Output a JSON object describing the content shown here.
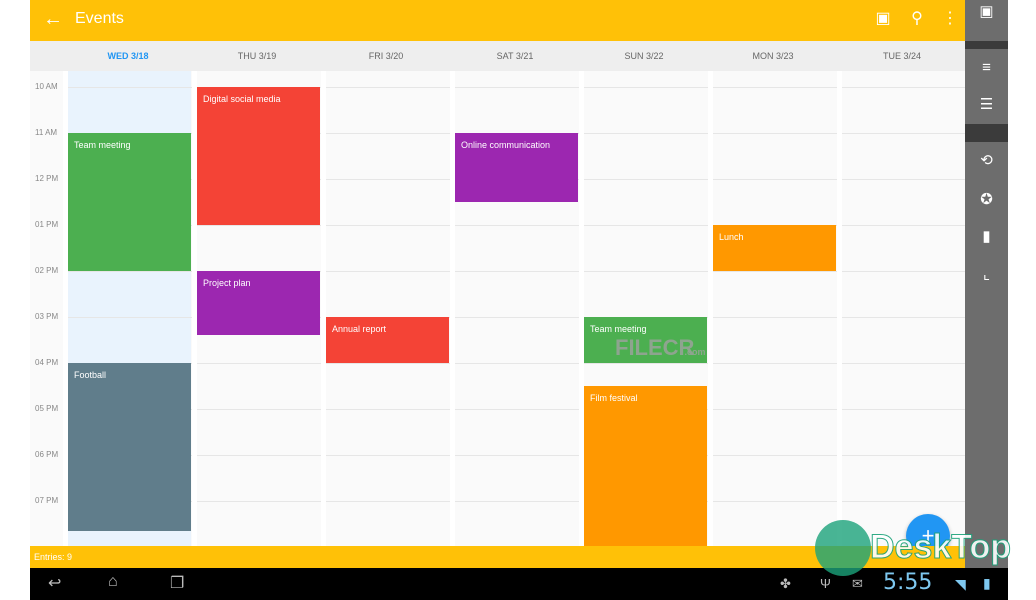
{
  "app": {
    "title": "Events",
    "back_icon": "arrow-left-icon"
  },
  "toolbar": {
    "icons": [
      "calendar-today-icon",
      "search-icon",
      "more-vert-icon"
    ]
  },
  "days": [
    {
      "label": "WED 3/18",
      "today": true
    },
    {
      "label": "THU 3/19"
    },
    {
      "label": "FRI 3/20"
    },
    {
      "label": "SAT 3/21"
    },
    {
      "label": "SUN 3/22"
    },
    {
      "label": "MON 3/23"
    },
    {
      "label": "TUE 3/24"
    }
  ],
  "times": [
    "10 AM",
    "11 AM",
    "12 PM",
    "01 PM",
    "02 PM",
    "03 PM",
    "04 PM",
    "05 PM",
    "06 PM",
    "07 PM"
  ],
  "events": [
    {
      "title": "Team meeting",
      "day": 0,
      "start": 11,
      "end": 14,
      "color": "#4caf50"
    },
    {
      "title": "Football",
      "day": 0,
      "start": 16,
      "end": 19.65,
      "color": "#607d8b"
    },
    {
      "title": "Digital social media",
      "day": 1,
      "start": 10,
      "end": 13,
      "color": "#f44336"
    },
    {
      "title": "Project plan",
      "day": 1,
      "start": 14,
      "end": 15.4,
      "color": "#9c27b0"
    },
    {
      "title": "Annual report",
      "day": 2,
      "start": 15,
      "end": 16,
      "color": "#f44336"
    },
    {
      "title": "Online communication",
      "day": 3,
      "start": 11,
      "end": 12.5,
      "color": "#9c27b0"
    },
    {
      "title": "Team meeting",
      "day": 4,
      "start": 15,
      "end": 16,
      "color": "#4caf50"
    },
    {
      "title": "Film festival",
      "day": 4,
      "start": 16.5,
      "end": 20,
      "color": "#ff9800"
    },
    {
      "title": "Lunch",
      "day": 5,
      "start": 13,
      "end": 14,
      "color": "#ff9800"
    }
  ],
  "footer": {
    "entries": "Entries: 9"
  },
  "fab": {
    "icon": "add-icon",
    "label": "+"
  },
  "side_actions": [
    "today-icon",
    "sort-icon",
    "filter-icon",
    "history-icon",
    "star-icon",
    "delete-icon",
    "chart-icon"
  ],
  "system": {
    "time": "5:55",
    "nav_icons": [
      "back-icon",
      "home-icon",
      "recents-icon"
    ],
    "status_icons": [
      "android-icon",
      "usb-icon",
      "gmail-icon",
      "wifi-icon",
      "battery-icon"
    ]
  },
  "watermarks": {
    "filecr": "FILECR",
    "filecr_sub": ".com",
    "desktop": "DeskTop"
  },
  "colors": {
    "accent": "#ffc107",
    "today": "#2196f3",
    "sidebar": "#6d6d6d"
  }
}
